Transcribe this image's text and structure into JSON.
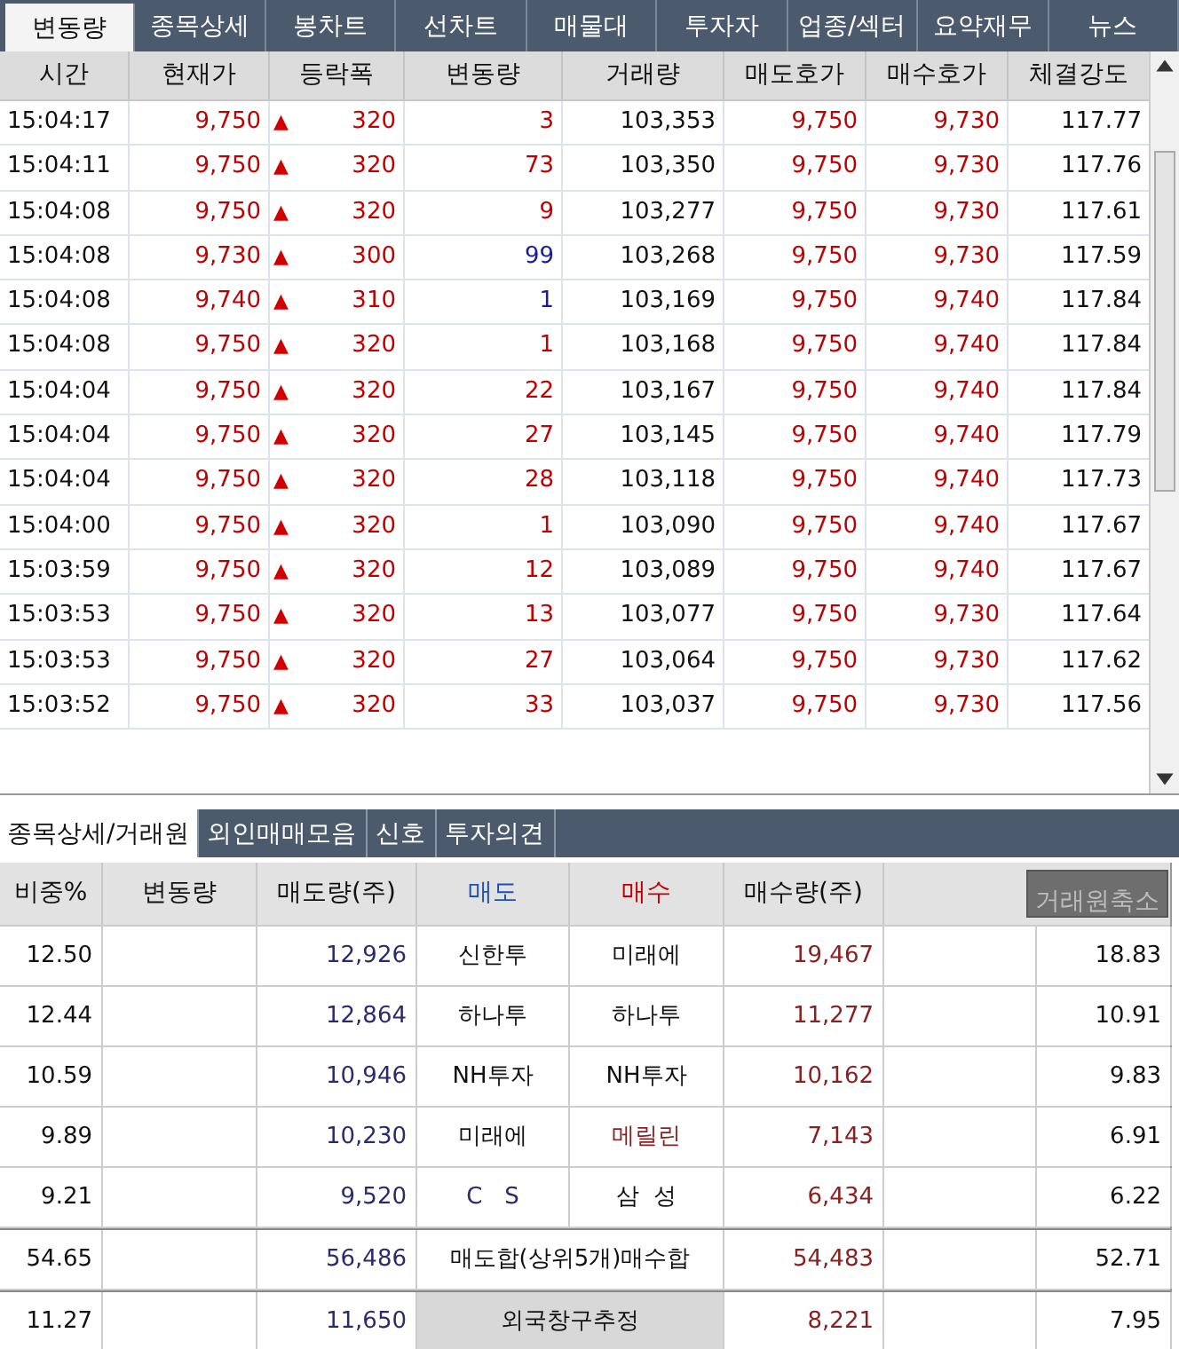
{
  "top_tabs": [
    {
      "label": "변동량",
      "selected": true
    },
    {
      "label": "종목상세",
      "selected": false
    },
    {
      "label": "봉차트",
      "selected": false
    },
    {
      "label": "선차트",
      "selected": false
    },
    {
      "label": "매물대",
      "selected": false
    },
    {
      "label": "투자자",
      "selected": false
    },
    {
      "label": "업종/섹터",
      "selected": false
    },
    {
      "label": "요약재무",
      "selected": false
    },
    {
      "label": "뉴스",
      "selected": false
    }
  ],
  "ticks": {
    "columns": [
      "시간",
      "현재가",
      "등락폭",
      "변동량",
      "거래량",
      "매도호가",
      "매수호가",
      "체결강도"
    ],
    "rows": [
      {
        "time": "15:04:17",
        "price": "9,750",
        "arrow": "▲",
        "change": "320",
        "volume_change": "3",
        "sell_side": false,
        "volume": "103,353",
        "ask": "9,750",
        "bid": "9,730",
        "strength": "117.77"
      },
      {
        "time": "15:04:11",
        "price": "9,750",
        "arrow": "▲",
        "change": "320",
        "volume_change": "73",
        "sell_side": false,
        "volume": "103,350",
        "ask": "9,750",
        "bid": "9,730",
        "strength": "117.76"
      },
      {
        "time": "15:04:08",
        "price": "9,750",
        "arrow": "▲",
        "change": "320",
        "volume_change": "9",
        "sell_side": false,
        "volume": "103,277",
        "ask": "9,750",
        "bid": "9,730",
        "strength": "117.61"
      },
      {
        "time": "15:04:08",
        "price": "9,730",
        "arrow": "▲",
        "change": "300",
        "volume_change": "99",
        "sell_side": true,
        "volume": "103,268",
        "ask": "9,750",
        "bid": "9,730",
        "strength": "117.59"
      },
      {
        "time": "15:04:08",
        "price": "9,740",
        "arrow": "▲",
        "change": "310",
        "volume_change": "1",
        "sell_side": true,
        "volume": "103,169",
        "ask": "9,750",
        "bid": "9,740",
        "strength": "117.84"
      },
      {
        "time": "15:04:08",
        "price": "9,750",
        "arrow": "▲",
        "change": "320",
        "volume_change": "1",
        "sell_side": false,
        "volume": "103,168",
        "ask": "9,750",
        "bid": "9,740",
        "strength": "117.84"
      },
      {
        "time": "15:04:04",
        "price": "9,750",
        "arrow": "▲",
        "change": "320",
        "volume_change": "22",
        "sell_side": false,
        "volume": "103,167",
        "ask": "9,750",
        "bid": "9,740",
        "strength": "117.84"
      },
      {
        "time": "15:04:04",
        "price": "9,750",
        "arrow": "▲",
        "change": "320",
        "volume_change": "27",
        "sell_side": false,
        "volume": "103,145",
        "ask": "9,750",
        "bid": "9,740",
        "strength": "117.79"
      },
      {
        "time": "15:04:04",
        "price": "9,750",
        "arrow": "▲",
        "change": "320",
        "volume_change": "28",
        "sell_side": false,
        "volume": "103,118",
        "ask": "9,750",
        "bid": "9,740",
        "strength": "117.73"
      },
      {
        "time": "15:04:00",
        "price": "9,750",
        "arrow": "▲",
        "change": "320",
        "volume_change": "1",
        "sell_side": false,
        "volume": "103,090",
        "ask": "9,750",
        "bid": "9,740",
        "strength": "117.67"
      },
      {
        "time": "15:03:59",
        "price": "9,750",
        "arrow": "▲",
        "change": "320",
        "volume_change": "12",
        "sell_side": false,
        "volume": "103,089",
        "ask": "9,750",
        "bid": "9,740",
        "strength": "117.67"
      },
      {
        "time": "15:03:53",
        "price": "9,750",
        "arrow": "▲",
        "change": "320",
        "volume_change": "13",
        "sell_side": false,
        "volume": "103,077",
        "ask": "9,750",
        "bid": "9,730",
        "strength": "117.64"
      },
      {
        "time": "15:03:53",
        "price": "9,750",
        "arrow": "▲",
        "change": "320",
        "volume_change": "27",
        "sell_side": false,
        "volume": "103,064",
        "ask": "9,750",
        "bid": "9,730",
        "strength": "117.62"
      },
      {
        "time": "15:03:52",
        "price": "9,750",
        "arrow": "▲",
        "change": "320",
        "volume_change": "33",
        "sell_side": false,
        "volume": "103,037",
        "ask": "9,750",
        "bid": "9,730",
        "strength": "117.56"
      }
    ]
  },
  "bottom_tabs": [
    {
      "label": "종목상세/거래원",
      "selected": true
    },
    {
      "label": "외인매매모음",
      "selected": false
    },
    {
      "label": "신호",
      "selected": false
    },
    {
      "label": "투자의견",
      "selected": false
    }
  ],
  "brokers": {
    "columns": [
      "비중%",
      "변동량",
      "매도량(주)",
      "매도",
      "매수",
      "매수량(주)"
    ],
    "collapse_button": "거래원축소",
    "rows": [
      {
        "sell_share": "12.50",
        "sell_qty": "12,926",
        "seller": "신한투",
        "seller_foreign": false,
        "buyer": "미래에",
        "buyer_foreign": false,
        "buy_qty": "19,467",
        "buy_share": "18.83"
      },
      {
        "sell_share": "12.44",
        "sell_qty": "12,864",
        "seller": "하나투",
        "seller_foreign": false,
        "buyer": "하나투",
        "buyer_foreign": false,
        "buy_qty": "11,277",
        "buy_share": "10.91"
      },
      {
        "sell_share": "10.59",
        "sell_qty": "10,946",
        "seller": "NH투자",
        "seller_foreign": false,
        "buyer": "NH투자",
        "buyer_foreign": false,
        "buy_qty": "10,162",
        "buy_share": "9.83"
      },
      {
        "sell_share": "9.89",
        "sell_qty": "10,230",
        "seller": "미래에",
        "seller_foreign": false,
        "buyer": "메릴린",
        "buyer_foreign": true,
        "buy_qty": "7,143",
        "buy_share": "6.91"
      },
      {
        "sell_share": "9.21",
        "sell_qty": "9,520",
        "seller": "C   S",
        "seller_foreign": true,
        "buyer": "삼  성",
        "buyer_foreign": false,
        "buy_qty": "6,434",
        "buy_share": "6.22"
      }
    ],
    "total": {
      "sell_share": "54.65",
      "sell_qty": "56,486",
      "label": "매도합(상위5개)매수합",
      "buy_qty": "54,483",
      "buy_share": "52.71"
    },
    "foreign": {
      "sell_share": "11.27",
      "sell_qty": "11,650",
      "label": "외국창구추정",
      "buy_qty": "8,221",
      "buy_share": "7.95"
    }
  }
}
